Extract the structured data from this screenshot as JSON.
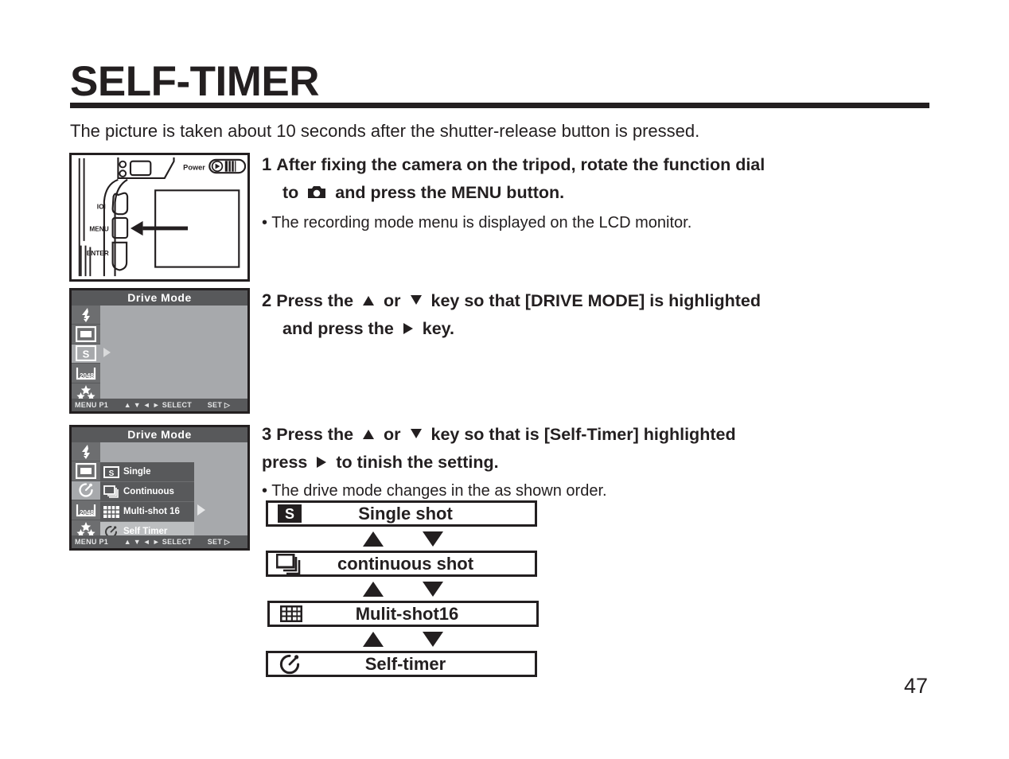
{
  "page": {
    "title": "SELF-TIMER",
    "intro": "The picture is taken about 10 seconds after the shutter-release button is pressed.",
    "number": "47"
  },
  "camera_figure": {
    "power_label": "Power",
    "display_button_label": "ΙΟΙ",
    "menu_button_label": "MENU",
    "enter_button_label": "ENTER"
  },
  "lcd1": {
    "title": "Drive Mode",
    "status": {
      "menu": "MENU P1",
      "keys": "▲ ▼ ◄ ►",
      "select": "SELECT",
      "set": "SET"
    },
    "rail": [
      {
        "icon": "flash-icon",
        "selected": false
      },
      {
        "icon": "frame-icon",
        "selected": false
      },
      {
        "icon": "single-s-icon",
        "selected": true
      },
      {
        "icon": "resolution-2048-icon",
        "selected": false,
        "label": "2048"
      },
      {
        "icon": "quality-stars-icon",
        "selected": false
      }
    ]
  },
  "lcd2": {
    "title": "Drive Mode",
    "status": {
      "menu": "MENU P1",
      "keys": "▲ ▼ ◄ ►",
      "select": "SELECT",
      "set": "SET"
    },
    "rail": [
      {
        "icon": "flash-icon",
        "selected": false
      },
      {
        "icon": "frame-icon",
        "selected": false
      },
      {
        "icon": "self-timer-icon",
        "selected": true
      },
      {
        "icon": "resolution-2048-icon",
        "selected": false,
        "label": "2048"
      },
      {
        "icon": "quality-stars-icon",
        "selected": false
      }
    ],
    "items": [
      {
        "label": "Single",
        "icon": "single-s-icon",
        "highlighted": false
      },
      {
        "label": "Continuous",
        "icon": "continuous-icon",
        "highlighted": false
      },
      {
        "label": "Multi-shot 16",
        "icon": "multishot-grid-icon",
        "highlighted": false
      },
      {
        "label": "Self Timer",
        "icon": "self-timer-icon",
        "highlighted": true
      }
    ]
  },
  "steps": [
    {
      "number": "1",
      "line1_before": "After fixing the camera on the tripod, rotate the function dial",
      "line2_before": "to",
      "line2_after": "and press the MENU button.",
      "note": "• The recording mode menu is displayed on the LCD monitor."
    },
    {
      "number": "2",
      "line1_a": "Press the",
      "line1_b": "or",
      "line1_c": "key so that [DRIVE MODE] is  highlighted",
      "line2_a": "and press the",
      "line2_b": "key."
    },
    {
      "number": "3",
      "line1_a": "Press the",
      "line1_b": "or",
      "line1_c": "key so that is [Self-Timer]  highlighted",
      "line2_a": "press",
      "line2_b": "to  tinish the setting.",
      "note": "• The drive mode changes in the as shown order."
    }
  ],
  "flow": {
    "items": [
      {
        "label": "Single shot",
        "icon": "single-s-icon"
      },
      {
        "label": "continuous shot",
        "icon": "continuous-icon"
      },
      {
        "label": "Mulit-shot16",
        "icon": "multishot-grid-icon"
      },
      {
        "label": "Self-timer",
        "icon": "self-timer-icon"
      }
    ]
  },
  "colors": {
    "ink": "#231f20",
    "lcd_dark": "#58595b",
    "lcd_mid": "#6d6e70",
    "lcd_light": "#a7a9ac",
    "lcd_highlight": "#bcbec0"
  }
}
